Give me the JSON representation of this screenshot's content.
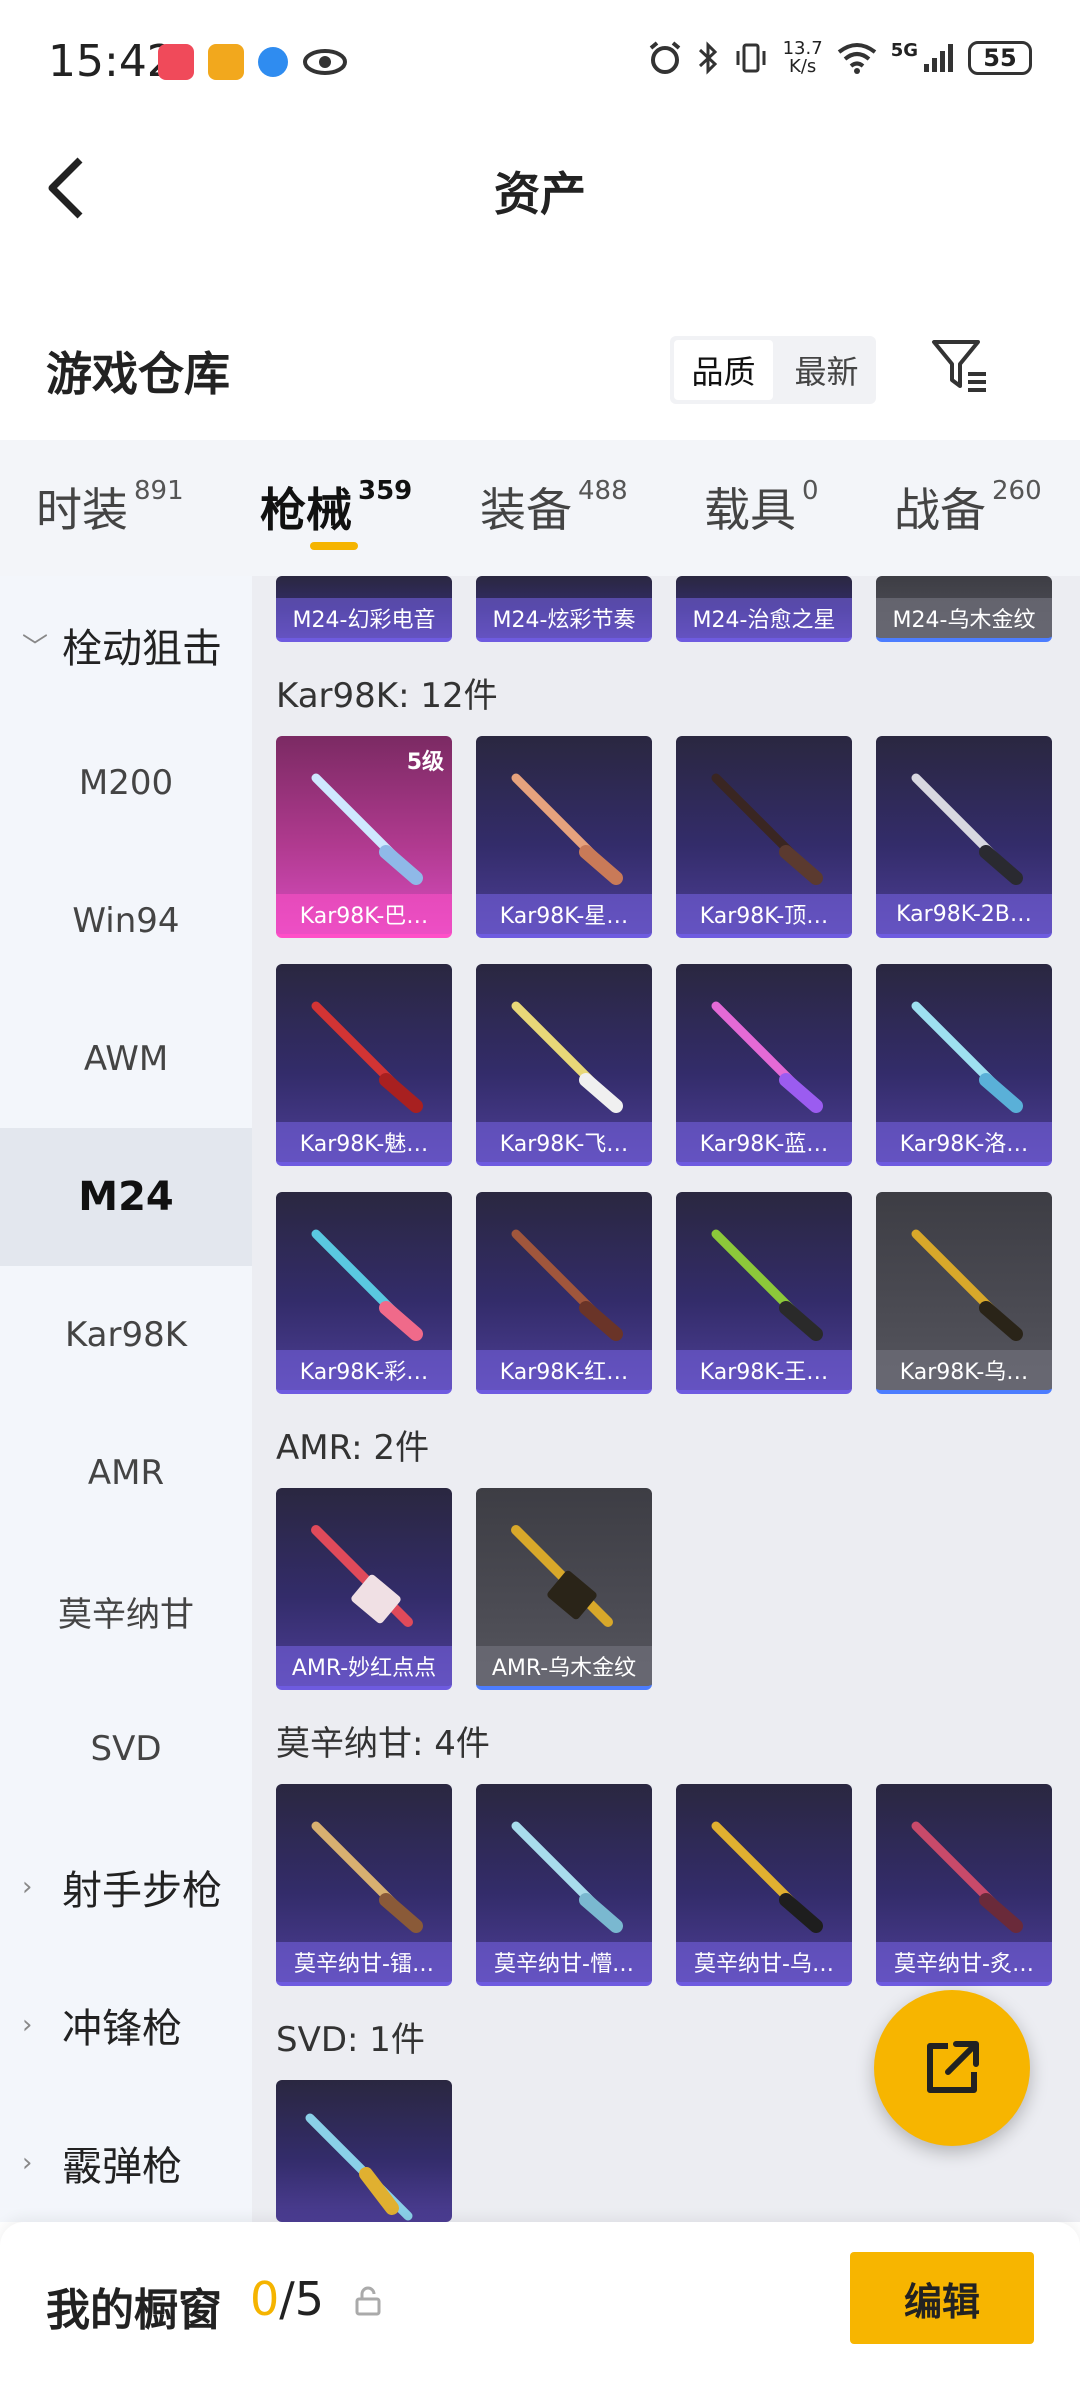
{
  "status_bar": {
    "time": "15:42",
    "net_speed_top": "13.7",
    "net_speed_bottom": "K/s",
    "network": "5G",
    "battery": "55"
  },
  "header": {
    "title": "资产"
  },
  "warehouse": {
    "title": "游戏仓库",
    "sort_options": [
      "品质",
      "最新"
    ],
    "sort_selected": "品质"
  },
  "tabs": [
    {
      "label": "时装",
      "count": "891"
    },
    {
      "label": "枪械",
      "count": "359",
      "active": true
    },
    {
      "label": "装备",
      "count": "488"
    },
    {
      "label": "载具",
      "count": "0"
    },
    {
      "label": "战备",
      "count": "260"
    }
  ],
  "sidebar": {
    "group_bolt": "栓动狙击",
    "items": [
      "M200",
      "Win94",
      "AWM",
      "M24",
      "Kar98K",
      "AMR",
      "莫辛纳甘",
      "SVD"
    ],
    "selected": "M24",
    "group_marksman": "射手步枪",
    "group_smg": "冲锋枪",
    "group_shotgun": "霰弹枪"
  },
  "sections": {
    "m24_top": [
      "M24-幻彩电音",
      "M24-炫彩节奏",
      "M24-治愈之星",
      "M24-乌木金纹"
    ],
    "kar98k_title": "Kar98K: 12件",
    "kar98k": [
      "Kar98K-巴…",
      "Kar98K-星…",
      "Kar98K-顶…",
      "Kar98K-2B…",
      "Kar98K-魅…",
      "Kar98K-飞…",
      "Kar98K-蓝…",
      "Kar98K-洛…",
      "Kar98K-彩…",
      "Kar98K-红…",
      "Kar98K-王…",
      "Kar98K-乌…"
    ],
    "kar98k_level": "5级",
    "amr_title": "AMR: 2件",
    "amr": [
      "AMR-妙红点点",
      "AMR-乌木金纹"
    ],
    "mosin_title": "莫辛纳甘: 4件",
    "mosin": [
      "莫辛纳甘-镭…",
      "莫辛纳甘-懵…",
      "莫辛纳甘-乌…",
      "莫辛纳甘-炙…"
    ],
    "svd_title": "SVD: 1件"
  },
  "bottom_bar": {
    "label": "我的橱窗",
    "current": "0",
    "total": "/5",
    "edit_label": "编辑"
  },
  "colors": {
    "accent": "#f7b500",
    "card_purple": "#4d3e95",
    "card_pink": "#d84dc0",
    "card_grey": "#4b4b53"
  }
}
